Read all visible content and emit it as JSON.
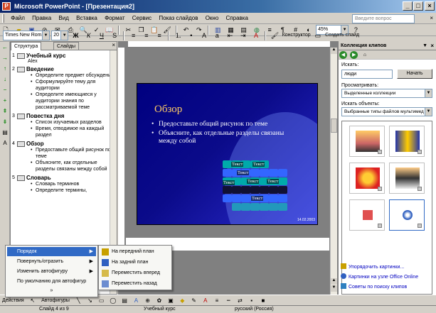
{
  "window": {
    "title": "Microsoft PowerPoint - [Презентация2]"
  },
  "menu": {
    "items": [
      "Файл",
      "Правка",
      "Вид",
      "Вставка",
      "Формат",
      "Сервис",
      "Показ слайдов",
      "Окно",
      "Справка"
    ],
    "help_placeholder": "Введите вопрос"
  },
  "toolbar": {
    "zoom": "45%",
    "font": "Times New Roman",
    "size": "20",
    "designer": "Конструктор",
    "new_slide": "Создать слайд"
  },
  "outline": {
    "tabs": [
      "Структура",
      "Слайды"
    ],
    "slides": [
      {
        "num": "1",
        "title": "Учебный курс",
        "sub": "Alex",
        "bullets": []
      },
      {
        "num": "2",
        "title": "Введение",
        "bullets": [
          "Определите предмет обсуждения",
          "Сформулируйте тему для аудитории",
          "Определите имеющиеся у аудитории знания по рассматриваемой теме"
        ]
      },
      {
        "num": "3",
        "title": "Повестка дня",
        "bullets": [
          "Список изучаемых разделов",
          "Время, отводимое на каждый раздел"
        ]
      },
      {
        "num": "4",
        "title": "Обзор",
        "bullets": [
          "Предоставьте общий рисунок по теме",
          "Объясните, как отдельные разделы связаны между собой"
        ]
      },
      {
        "num": "5",
        "title": "Словарь",
        "bullets": [
          "Словарь терминов",
          "Определите термины,"
        ]
      }
    ]
  },
  "slide": {
    "title": "Обзор",
    "bullets": [
      "Предоставьте общий рисунок по теме",
      "Объясните, как отдельные разделы связаны между собой"
    ],
    "puzzle_labels": [
      "Текст",
      "Текст",
      "Текст",
      "Текст",
      "Текст",
      "Текст",
      "Текст"
    ],
    "footer": "14.02.2003"
  },
  "taskpane": {
    "title": "Коллекция клипов",
    "search_label": "Искать:",
    "search_value": "люди",
    "search_button": "Начать",
    "browse_label": "Просматривать:",
    "browse_value": "Выделенные коллекции",
    "objects_label": "Искать объекты:",
    "objects_value": "Выбранные типы файлов мультимед",
    "links": [
      "Упорядочить картинки...",
      "Картинки на узле Office Online",
      "Советы по поиску клипов"
    ]
  },
  "context_menu": {
    "items": [
      "Порядок",
      "Повернуть/отразить",
      "Изменить автофигуру",
      "По умолчанию для автофигур"
    ],
    "more": "»"
  },
  "submenu": {
    "items": [
      "На передний план",
      "На задний план",
      "Переместить вперед",
      "Переместить назад"
    ]
  },
  "drawbar": {
    "actions": "Действия",
    "autoshapes": "Автофигуры"
  },
  "status": {
    "slide": "Слайд 4 из 9",
    "design": "Учебный курс",
    "lang": "русский (Россия)"
  }
}
